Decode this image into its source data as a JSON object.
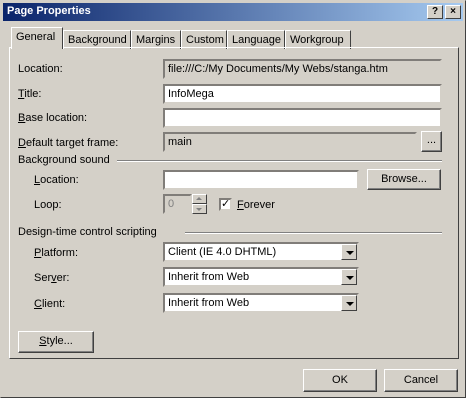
{
  "window": {
    "title": "Page Properties",
    "help_label": "?",
    "close_label": "×"
  },
  "tabs": [
    {
      "label": "General"
    },
    {
      "label": "Background"
    },
    {
      "label": "Margins"
    },
    {
      "label": "Custom"
    },
    {
      "label": "Language"
    },
    {
      "label": "Workgroup"
    }
  ],
  "general": {
    "location_label": "Location:",
    "location_value": "file:///C:/My Documents/My Webs/stanga.htm",
    "title_label_u": "T",
    "title_label_rest": "itle:",
    "title_value": "InfoMega",
    "base_label_u": "B",
    "base_label_rest": "ase location:",
    "base_value": "",
    "target_label_u": "D",
    "target_label_rest": "efault target frame:",
    "target_value": "main",
    "target_button": "...",
    "bg_sound_heading": "Background sound",
    "sound_location_label_u": "L",
    "sound_location_label_rest": "ocation:",
    "sound_location_value": "",
    "browse_label": "Browse...",
    "loop_label": "Loop:",
    "loop_value": "0",
    "forever_label_u": "F",
    "forever_label_rest": "orever",
    "forever_checked": "✓",
    "design_heading": "Design-time control scripting",
    "platform_label_u": "P",
    "platform_label_rest": "latform:",
    "platform_value": "Client (IE 4.0 DHTML)",
    "server_label_pre": "Ser",
    "server_label_u": "v",
    "server_label_rest": "er:",
    "server_value": "Inherit from Web",
    "client_label_u": "C",
    "client_label_rest": "lient:",
    "client_value": "Inherit from Web",
    "style_label_u": "S",
    "style_label_rest": "tyle..."
  },
  "footer": {
    "ok_label": "OK",
    "cancel_label": "Cancel"
  }
}
